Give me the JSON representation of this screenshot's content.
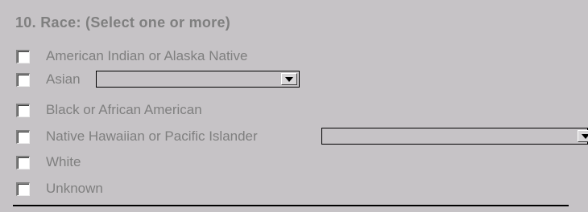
{
  "section": {
    "title": "10. Race: (Select one or more)"
  },
  "options": [
    {
      "label": "American Indian or Alaska Native",
      "checked": false
    },
    {
      "label": "Asian",
      "checked": false
    },
    {
      "label": "Black or African American",
      "checked": false
    },
    {
      "label": "Native Hawaiian or Pacific Islander",
      "checked": false
    },
    {
      "label": "White",
      "checked": false
    },
    {
      "label": "Unknown",
      "checked": false
    }
  ],
  "dropdowns": {
    "asian_subgroup": {
      "selected": ""
    },
    "pacific_islander_subgroup": {
      "selected": ""
    }
  },
  "icons": {
    "dropdown_arrow": "chevron-down-icon",
    "checkbox": "checkbox-icon"
  }
}
